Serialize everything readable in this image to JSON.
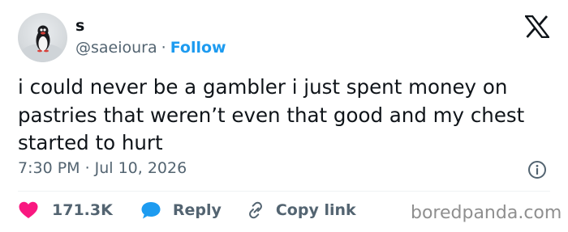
{
  "author": {
    "name": "s",
    "handle": "@saeioura",
    "separator": "·",
    "follow_label": "Follow"
  },
  "tweet": {
    "text": "i could never be a gambler i just spent money on pastries that weren’t even that good and my chest started to hurt",
    "time": "7:30 PM",
    "meta_separator": "·",
    "date": "Jul 10, 2026"
  },
  "actions": {
    "like_count": "171.3K",
    "reply_label": "Reply",
    "copy_link_label": "Copy link"
  },
  "watermark": "boredpanda.com",
  "icons": {
    "avatar": "penguin-avatar",
    "brand": "x-logo-icon",
    "info": "info-icon",
    "like": "heart-icon",
    "reply": "speech-bubble-icon",
    "copy": "link-icon"
  },
  "colors": {
    "text": "#0f1419",
    "secondary": "#536471",
    "accent": "#1d9bf0",
    "like": "#f91880",
    "watermark": "#8f8f8f"
  }
}
